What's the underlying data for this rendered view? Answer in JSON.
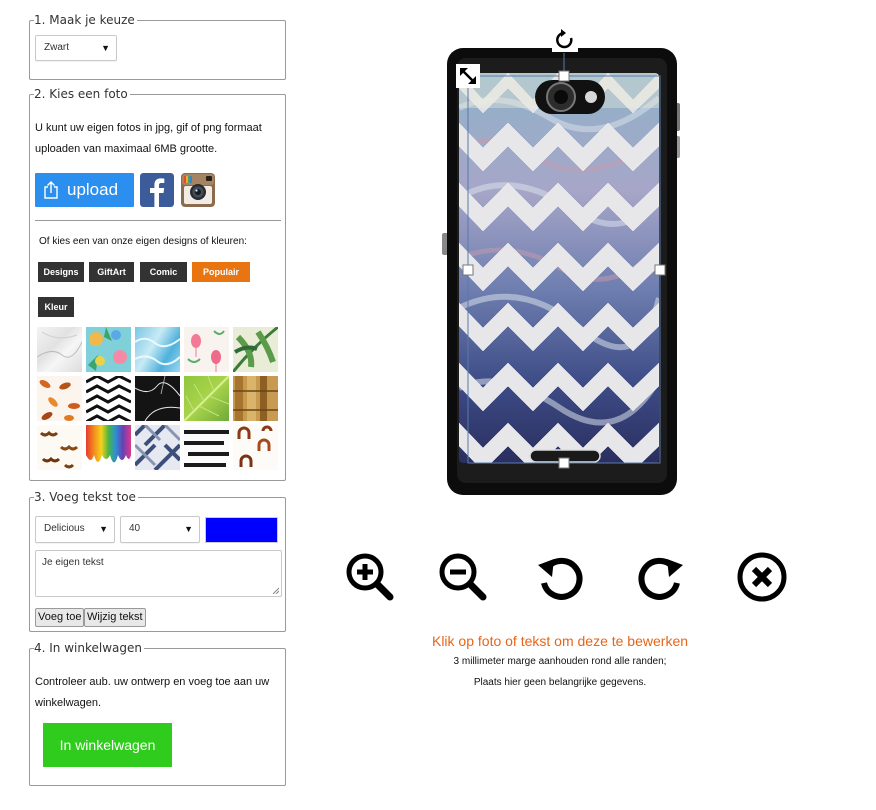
{
  "step1": {
    "legend": "1. Maak je keuze",
    "color_select": "Zwart"
  },
  "step2": {
    "legend": "2. Kies een foto",
    "desc_line1": "U kunt uw eigen fotos in jpg, gif of png formaat",
    "desc_line2": "uploaden van maximaal 6MB grootte.",
    "upload_label": "upload",
    "designs_prompt": "Of kies een van onze eigen designs of kleuren:",
    "tabs": [
      "Designs",
      "GiftArt",
      "Comic",
      "Populair",
      "Kleur"
    ],
    "active_tab_color": "#e8750f",
    "patterns": [
      "marble-white",
      "pineapple-tropical",
      "water-aqua",
      "flamingo",
      "palm-leaves",
      "autumn-leaves",
      "chevron-black-white",
      "marble-black",
      "green-leaf",
      "bamboo",
      "mustache",
      "rainbow-drip",
      "herringbone-blue",
      "brush-stripes",
      "horseshoe"
    ]
  },
  "step3": {
    "legend": "3. Voeg tekst toe",
    "font_select": "Delicious",
    "size_select": "40",
    "text_color": "#0000ff",
    "textarea_value": "Je eigen tekst",
    "add_button": "Voeg toe",
    "edit_button": "Wijzig tekst"
  },
  "step4": {
    "legend": "4. In winkelwagen",
    "desc_line1": "Controleer aub. uw ontwerp en voeg toe aan uw",
    "desc_line2": "winkelwagen.",
    "cart_button": "In winkelwagen",
    "cart_color": "#2fcc1e"
  },
  "toolbar": {
    "icons": [
      "zoom-in-icon",
      "zoom-out-icon",
      "rotate-left-icon",
      "rotate-right-icon",
      "delete-icon"
    ]
  },
  "hints": {
    "main": "Klik op foto of tekst om deze te bewerken",
    "line1": "3 millimeter marge aanhouden rond alle randen;",
    "line2": "Plaats hier geen belangrijke gegevens."
  },
  "colors": {
    "hint_orange": "#e5651a",
    "upload_blue": "#2b8ff0"
  }
}
